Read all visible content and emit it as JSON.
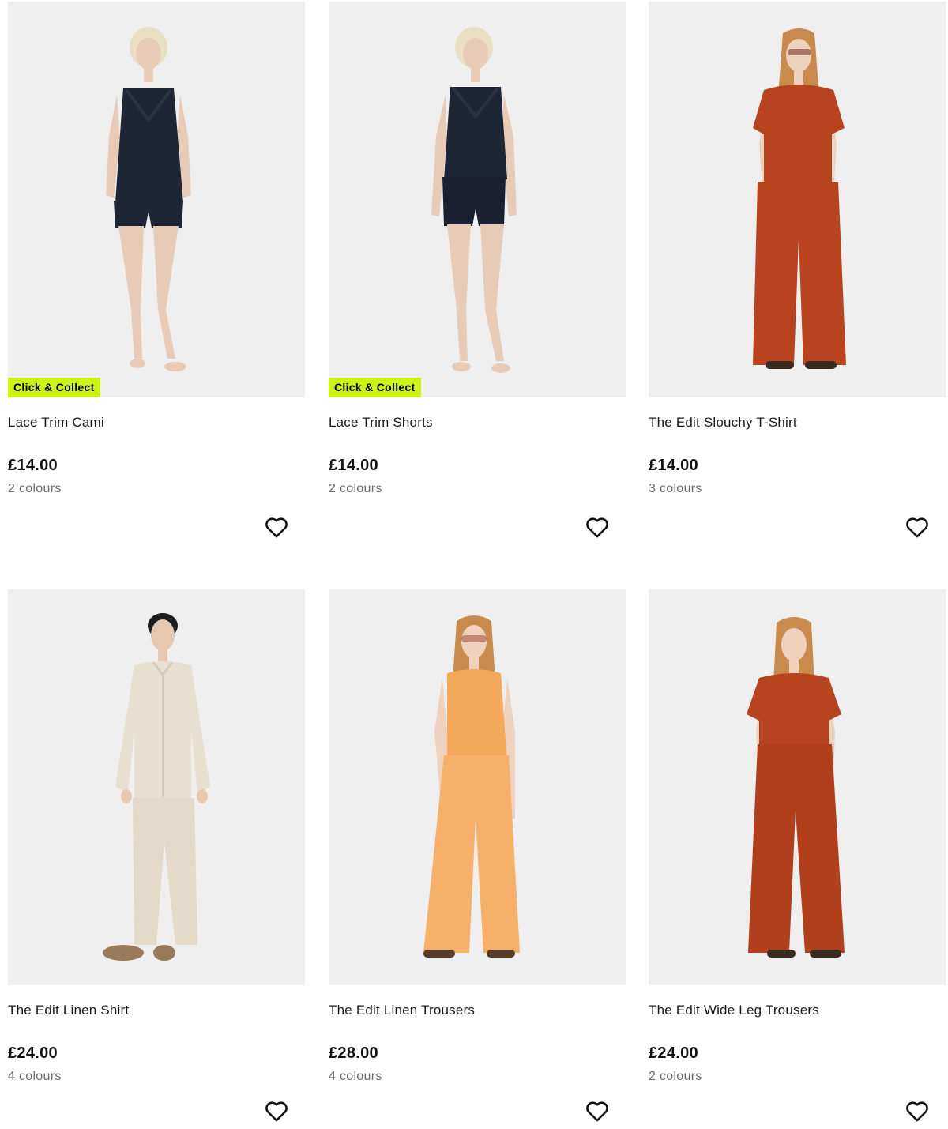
{
  "products": [
    {
      "name": "Lace Trim Cami",
      "price": "£14.00",
      "colours": "2 colours",
      "badge": "Click & Collect",
      "icon": "heart-outline-icon",
      "colors": {
        "bg": "#efefef",
        "top": "#1e2535",
        "bottom": "#1e2535",
        "hair": "#e9dfc4",
        "skin": "#e8cbb6"
      }
    },
    {
      "name": "Lace Trim Shorts",
      "price": "£14.00",
      "colours": "2 colours",
      "badge": "Click & Collect",
      "icon": "heart-outline-icon",
      "colors": {
        "bg": "#efefef",
        "top": "#1e2535",
        "bottom": "#1a2030",
        "hair": "#e9dfc4",
        "skin": "#e8cbb6"
      }
    },
    {
      "name": "The Edit Slouchy T-Shirt",
      "price": "£14.00",
      "colours": "3 colours",
      "badge": "",
      "icon": "heart-outline-icon",
      "colors": {
        "bg": "#efefef",
        "top": "#b8431f",
        "bottom": "#b8431f",
        "hair": "#c98a4e",
        "skin": "#efd2bd"
      }
    },
    {
      "name": "The Edit Linen Shirt",
      "price": "£24.00",
      "colours": "4 colours",
      "badge": "",
      "icon": "heart-outline-icon",
      "colors": {
        "bg": "#efefef",
        "top": "#e7dfd0",
        "bottom": "#e3dac9",
        "hair": "#1c1c1c",
        "skin": "#e6c8b0"
      }
    },
    {
      "name": "The Edit Linen Trousers",
      "price": "£28.00",
      "colours": "4 colours",
      "badge": "",
      "icon": "heart-outline-icon",
      "colors": {
        "bg": "#efefef",
        "top": "#f4a85b",
        "bottom": "#f6b06a",
        "hair": "#c98a4e",
        "skin": "#efd2bd"
      }
    },
    {
      "name": "The Edit Wide Leg Trousers",
      "price": "£24.00",
      "colours": "2 colours",
      "badge": "",
      "icon": "heart-outline-icon",
      "colors": {
        "bg": "#efefef",
        "top": "#b8431f",
        "bottom": "#b23f1c",
        "hair": "#c98a4e",
        "skin": "#efd2bd"
      }
    }
  ],
  "badge_color": "#cbf416"
}
